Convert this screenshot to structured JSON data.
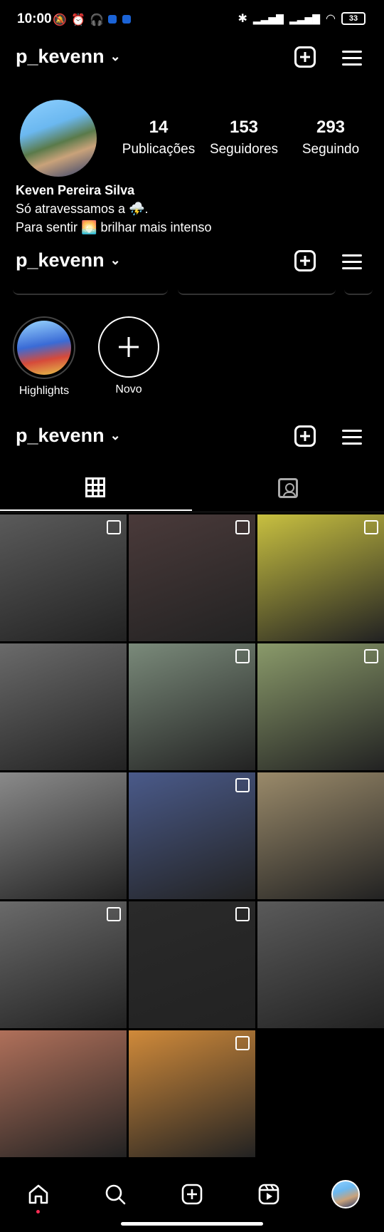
{
  "status_bar": {
    "time": "10:00",
    "battery": "33"
  },
  "header": {
    "username": "p_kevenn"
  },
  "profile": {
    "stats": [
      {
        "value": "14",
        "label": "Publicações"
      },
      {
        "value": "153",
        "label": "Seguidores"
      },
      {
        "value": "293",
        "label": "Seguindo"
      }
    ],
    "name": "Keven Pereira Silva",
    "bio_line1": "Só atravessamos a ⛈️.",
    "bio_line2": "Para sentir 🌅 brilhar mais intenso"
  },
  "highlights": [
    {
      "label": "Highlights"
    },
    {
      "label": "Novo"
    }
  ],
  "icons": {
    "status": [
      "mute-icon",
      "alarm-icon",
      "headphones-icon",
      "app-icon",
      "app-icon",
      "bluetooth-icon",
      "signal-icon",
      "signal-icon",
      "wifi-icon",
      "battery-icon"
    ],
    "header": [
      "chevron-down-icon",
      "new-post-icon",
      "menu-icon"
    ],
    "tabs": [
      "grid-icon",
      "tagged-icon"
    ],
    "nav": [
      "home-icon",
      "search-icon",
      "create-icon",
      "reels-icon",
      "profile-avatar"
    ]
  },
  "grid": [
    {
      "bg": "#5a5a5a",
      "multi": true
    },
    {
      "bg": "#4a3a3a",
      "multi": true
    },
    {
      "bg": "#c8c040",
      "multi": true
    },
    {
      "bg": "#6a6a6a",
      "multi": false
    },
    {
      "bg": "#7a8a7a",
      "multi": true
    },
    {
      "bg": "#8a9a6a",
      "multi": true
    },
    {
      "bg": "#8a8a8a",
      "multi": false
    },
    {
      "bg": "#4a5a8a",
      "multi": true
    },
    {
      "bg": "#9a8a6a",
      "multi": false
    },
    {
      "bg": "#6a6a6a",
      "multi": true
    },
    {
      "bg": "#2a2a2a",
      "multi": true
    },
    {
      "bg": "#5a5a5a",
      "multi": false
    },
    {
      "bg": "#b0705a",
      "multi": false
    },
    {
      "bg": "#d08a3a",
      "multi": true
    }
  ],
  "colors": {
    "background": "#000000",
    "text": "#ffffff",
    "notification_dot": "#ff2d55"
  }
}
